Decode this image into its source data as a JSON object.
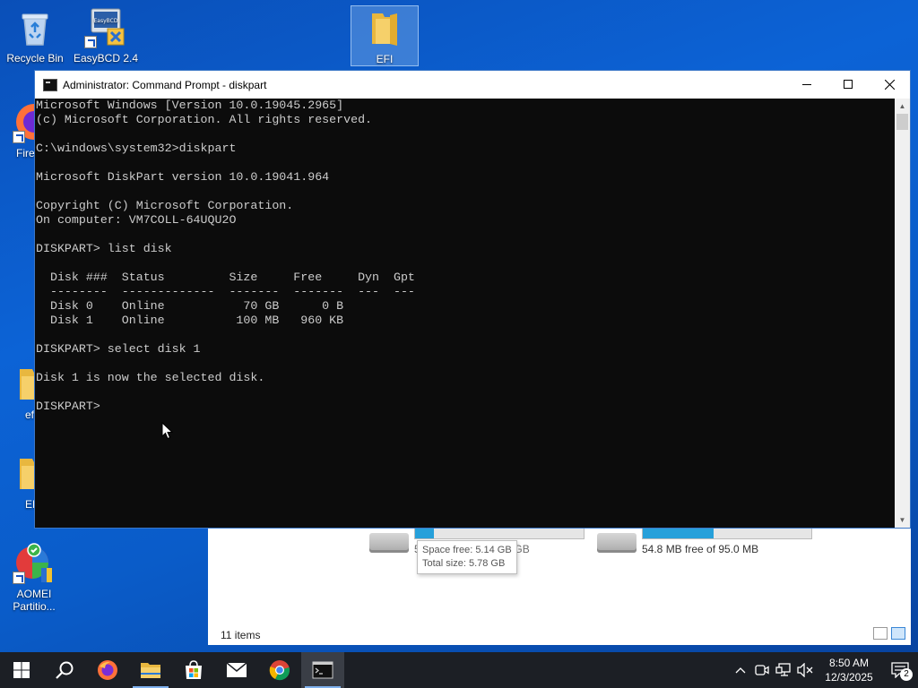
{
  "desktop": {
    "icons": [
      {
        "label": "Recycle Bin"
      },
      {
        "label": "EasyBCD 2.4"
      },
      {
        "label": "EFI"
      },
      {
        "label": "Fire"
      },
      {
        "label": "ef"
      },
      {
        "label": "EF"
      },
      {
        "label": "AOMEI Partitio..."
      }
    ]
  },
  "explorer": {
    "drives": [
      {
        "text": "5.14 GB free of 5.78 GB",
        "fill_fraction": 0.11
      },
      {
        "text": "54.8 MB free of 95.0 MB",
        "fill_fraction": 0.42
      }
    ],
    "tooltip": {
      "line1": "Space free: 5.14 GB",
      "line2": "Total size: 5.78 GB"
    },
    "status": "11 items"
  },
  "cmd": {
    "title": "Administrator: Command Prompt - diskpart",
    "lines": [
      "Microsoft Windows [Version 10.0.19045.2965]",
      "(c) Microsoft Corporation. All rights reserved.",
      "",
      "C:\\windows\\system32>diskpart",
      "",
      "Microsoft DiskPart version 10.0.19041.964",
      "",
      "Copyright (C) Microsoft Corporation.",
      "On computer: VM7COLL-64UQU2O",
      "",
      "DISKPART> list disk",
      "",
      "  Disk ###  Status         Size     Free     Dyn  Gpt",
      "  --------  -------------  -------  -------  ---  ---",
      "  Disk 0    Online           70 GB      0 B",
      "  Disk 1    Online          100 MB   960 KB",
      "",
      "DISKPART> select disk 1",
      "",
      "Disk 1 is now the selected disk.",
      "",
      "DISKPART> "
    ]
  },
  "taskbar": {
    "apps": [
      "start",
      "search",
      "firefox",
      "file-explorer",
      "store",
      "mail",
      "chrome",
      "command-prompt"
    ],
    "clock": {
      "time": "8:50 AM",
      "date": "12/3/2025"
    },
    "notification_count": "2"
  },
  "colors": {
    "console_bg": "#0c0c0c",
    "console_fg": "#cccccc",
    "taskbar_bg": "#1c1f25",
    "desktop_blue": "#0c63d6"
  }
}
